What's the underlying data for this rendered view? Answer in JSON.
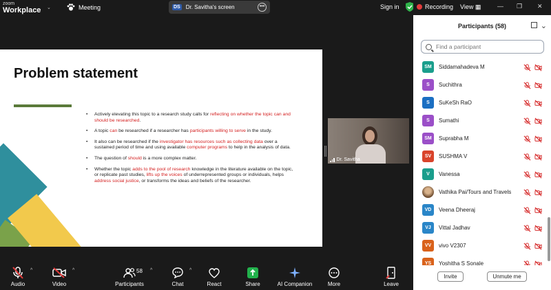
{
  "app": {
    "brand_line1": "zoom",
    "brand_line2": "Workplace"
  },
  "topbar": {
    "meeting_label": "Meeting",
    "screen_share_initials": "DS",
    "screen_share_label": "Dr. Savitha's screen",
    "signin_label": "Sign in",
    "recording_label": "Recording",
    "view_label": "View"
  },
  "slide": {
    "title": "Problem statement",
    "bullets": [
      [
        "Actively elevating this topic to a research study calls for ",
        "reflecting on whether the topic can and should be researched",
        "."
      ],
      [
        "A topic ",
        "can",
        " be researched if a researcher has ",
        "participants willing to serve",
        " in the study."
      ],
      [
        "It also can be researched if the ",
        "investigator has resources such as collecting data",
        " over a sustained period of time and using available ",
        "computer programs",
        " to help in the analysis of data."
      ],
      [
        "The question of ",
        "should",
        " is a more complex matter."
      ],
      [
        "Whether the topic ",
        "adds to the pool of research",
        " knowledge in the literature available on the topic, or replicate past studies, ",
        "lifts up the voices",
        " of underrepresented groups or individuals, helps ",
        "address social justice",
        ", or transforms the ideas and beliefs of the researcher."
      ]
    ]
  },
  "video": {
    "name": "Dr. Savitha"
  },
  "toolbar": {
    "audio": "Audio",
    "video": "Video",
    "participants": "Participants",
    "participants_count": "58",
    "chat": "Chat",
    "react": "React",
    "share": "Share",
    "ai": "AI Companion",
    "more": "More",
    "leave": "Leave"
  },
  "panel": {
    "title": "Participants (58)",
    "search_placeholder": "Find a participant",
    "invite_label": "Invite",
    "unmute_label": "Unmute me",
    "participants": [
      {
        "initials": "SM",
        "name": "Siddamahadeva M",
        "color": "#1a9e8c"
      },
      {
        "initials": "S",
        "name": "Suchithra",
        "color": "#9b4fc8"
      },
      {
        "initials": "S",
        "name": "SuKeSh RaO",
        "color": "#1b6fc2"
      },
      {
        "initials": "S",
        "name": "Sumathi",
        "color": "#9b4fc8"
      },
      {
        "initials": "SM",
        "name": "Suprabha M",
        "color": "#9b4fc8"
      },
      {
        "initials": "SV",
        "name": "SUSHMA V",
        "color": "#d9442b"
      },
      {
        "initials": "V",
        "name": "Vanessa",
        "color": "#1a9e8c"
      },
      {
        "initials": "",
        "name": "Vathika Pai/Tours and Travels",
        "color": "#7a5a3a"
      },
      {
        "initials": "VD",
        "name": "Veena Dheeraj",
        "color": "#2a86c8"
      },
      {
        "initials": "VJ",
        "name": "Vittal Jadhav",
        "color": "#2a86c8"
      },
      {
        "initials": "VV",
        "name": "vivo V2307",
        "color": "#d9621b"
      },
      {
        "initials": "YS",
        "name": "Yoshitha S Sonale",
        "color": "#d9621b"
      }
    ]
  },
  "colors": {
    "accent": "#0b5cff",
    "muted_red": "#d42020",
    "slide_bar": "#5a7a3a"
  }
}
